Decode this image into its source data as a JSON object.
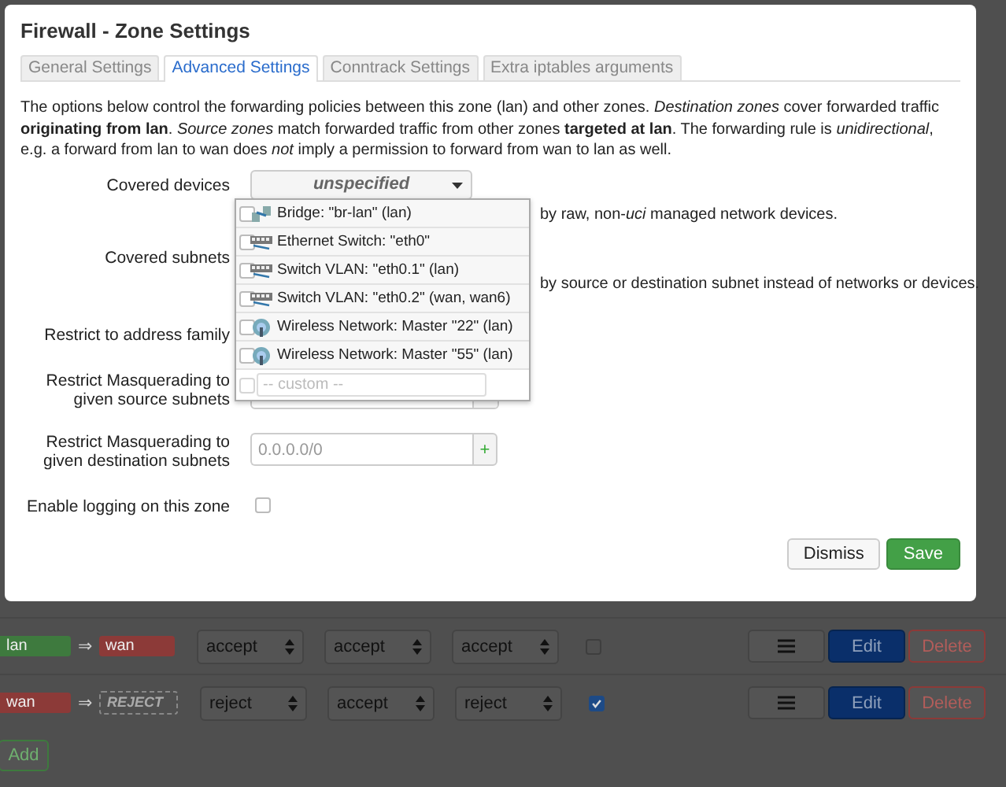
{
  "window": {
    "title": "Firewall - Zone Settings"
  },
  "tabs": [
    {
      "label": "General Settings",
      "selected": false
    },
    {
      "label": "Advanced Settings",
      "selected": true
    },
    {
      "label": "Conntrack Settings",
      "selected": false
    },
    {
      "label": "Extra iptables arguments",
      "selected": false
    }
  ],
  "intro": "The options below control the forwarding policies between this zone (lan) and other zones. *Destination zones* cover forwarded traffic **originating from lan**. *Source zones* match forwarded traffic from other zones **targeted at lan**. The forwarding rule is *unidirectional*, e.g. a forward from lan to wan does *not* imply a permission to forward from wan to lan as well.",
  "covered_devices": {
    "label": "Covered devices",
    "value": "unspecified",
    "hint": "by raw, non-*uci* managed network devices."
  },
  "covered_subnets": {
    "label": "Covered subnets",
    "hint": "by source or destination subnet instead of networks or devices."
  },
  "address_family": {
    "label": "Restrict to address family"
  },
  "masq_src": {
    "label": "Restrict Masquerading to given source subnets"
  },
  "masq_dest": {
    "label": "Restrict Masquerading to given destination subnets",
    "placeholder": "0.0.0.0/0",
    "add": "+"
  },
  "logging": {
    "label": "Enable logging on this zone",
    "checked": false
  },
  "dropdown": {
    "options": [
      {
        "kind": "bridge",
        "label": "Bridge: \"br-lan\" (lan)",
        "checked": false
      },
      {
        "kind": "switch",
        "label": "Ethernet Switch: \"eth0\"",
        "checked": false
      },
      {
        "kind": "switch",
        "label": "Switch VLAN: \"eth0.1\" (lan)",
        "checked": false
      },
      {
        "kind": "switch",
        "label": "Switch VLAN: \"eth0.2\" (wan, wan6)",
        "checked": false
      },
      {
        "kind": "wireless",
        "label": "Wireless Network: Master \"22\" (lan)",
        "checked": false
      },
      {
        "kind": "wireless",
        "label": "Wireless Network: Master \"55\" (lan)",
        "checked": false
      }
    ],
    "custom_checked": false,
    "custom_placeholder": "-- custom --"
  },
  "buttons": [
    {
      "label": "Dismiss",
      "kind": "default"
    },
    {
      "label": "Save",
      "kind": "primary"
    }
  ],
  "zones": [
    {
      "source": {
        "label": "lan",
        "color": "#3e7a3e"
      },
      "arrow": "⇒",
      "dest": {
        "kind": "zone",
        "label": "wan",
        "color": "#8c3a38"
      },
      "policies": [
        "accept",
        "accept",
        "accept"
      ],
      "masquerade": false,
      "edit": "Edit",
      "delete": "Delete"
    },
    {
      "source": {
        "label": "wan",
        "color": "#8c3a38"
      },
      "arrow": "⇒",
      "dest": {
        "kind": "reject",
        "label": "REJECT"
      },
      "policies": [
        "reject",
        "accept",
        "reject"
      ],
      "masquerade": true,
      "edit": "Edit",
      "delete": "Delete"
    }
  ],
  "add_button": "Add"
}
